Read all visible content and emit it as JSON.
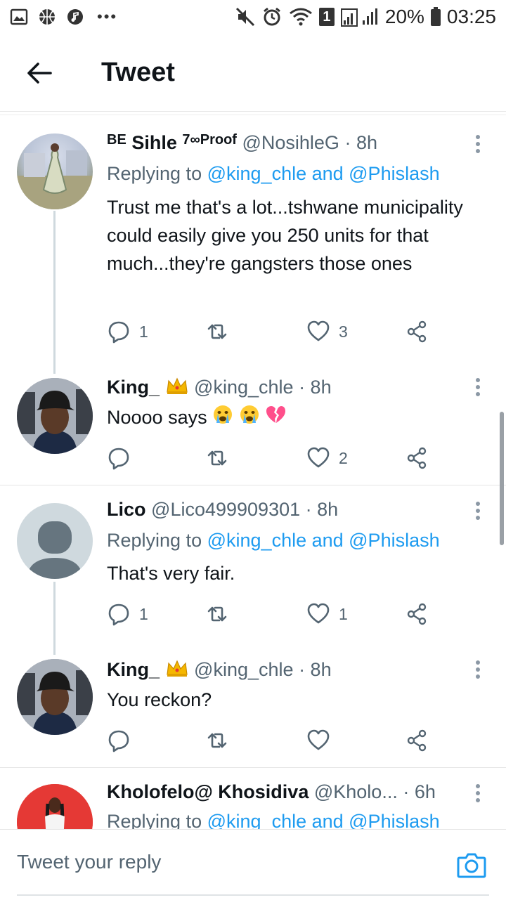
{
  "status_bar": {
    "battery_percent": "20%",
    "time": "03:25",
    "sim_slot": "1",
    "icons": [
      "gallery-icon",
      "basketball-icon",
      "music-icon",
      "more-dots-icon",
      "mute-icon",
      "alarm-icon",
      "wifi-icon",
      "sim-icon",
      "signal-icon",
      "battery-icon"
    ]
  },
  "header": {
    "title": "Tweet",
    "back_icon": "arrow-left-icon"
  },
  "tweets": [
    {
      "name": "Sihle",
      "name_prefix": "BE",
      "name_suffix": "7∞Proof",
      "handle": "@NosihleG",
      "time": "· 8h",
      "replying_prefix": "Replying to",
      "replying_users": "@king_chle and @Phislash",
      "text": "Trust me that's a lot...tshwane municipality could easily give you 250 units for that much...they're gangsters those ones",
      "replies": "1",
      "retweets": "",
      "likes": "3"
    },
    {
      "name": "King_",
      "name_badge": "crown-emoji",
      "handle": "@king_chle",
      "time": "· 8h",
      "text": "Noooo says",
      "emojis": [
        "crying-face-emoji",
        "crying-face-emoji",
        "broken-heart-emoji"
      ],
      "replies": "",
      "retweets": "",
      "likes": "2"
    },
    {
      "name": "Lico",
      "handle": "@Lico499909301",
      "time": "· 8h",
      "replying_prefix": "Replying to",
      "replying_users": "@king_chle and @Phislash",
      "text": "That's very fair.",
      "replies": "1",
      "retweets": "",
      "likes": "1"
    },
    {
      "name": "King_",
      "name_badge": "crown-emoji",
      "handle": "@king_chle",
      "time": "· 8h",
      "text": "You reckon?",
      "replies": "",
      "retweets": "",
      "likes": ""
    },
    {
      "name": "Kholofelo@ Khosidiva",
      "handle": "@Kholo...",
      "time": "· 6h",
      "replying_prefix": "Replying to",
      "replying_users": "@king_chle and @Phislash"
    }
  ],
  "reply_bar": {
    "placeholder": "Tweet your reply",
    "camera_icon": "camera-icon"
  },
  "colors": {
    "accent": "#1d9bf0",
    "text": "#0f1419",
    "secondary": "#536471",
    "divider": "#e6e6e6",
    "thread_line": "#cfd9de"
  }
}
